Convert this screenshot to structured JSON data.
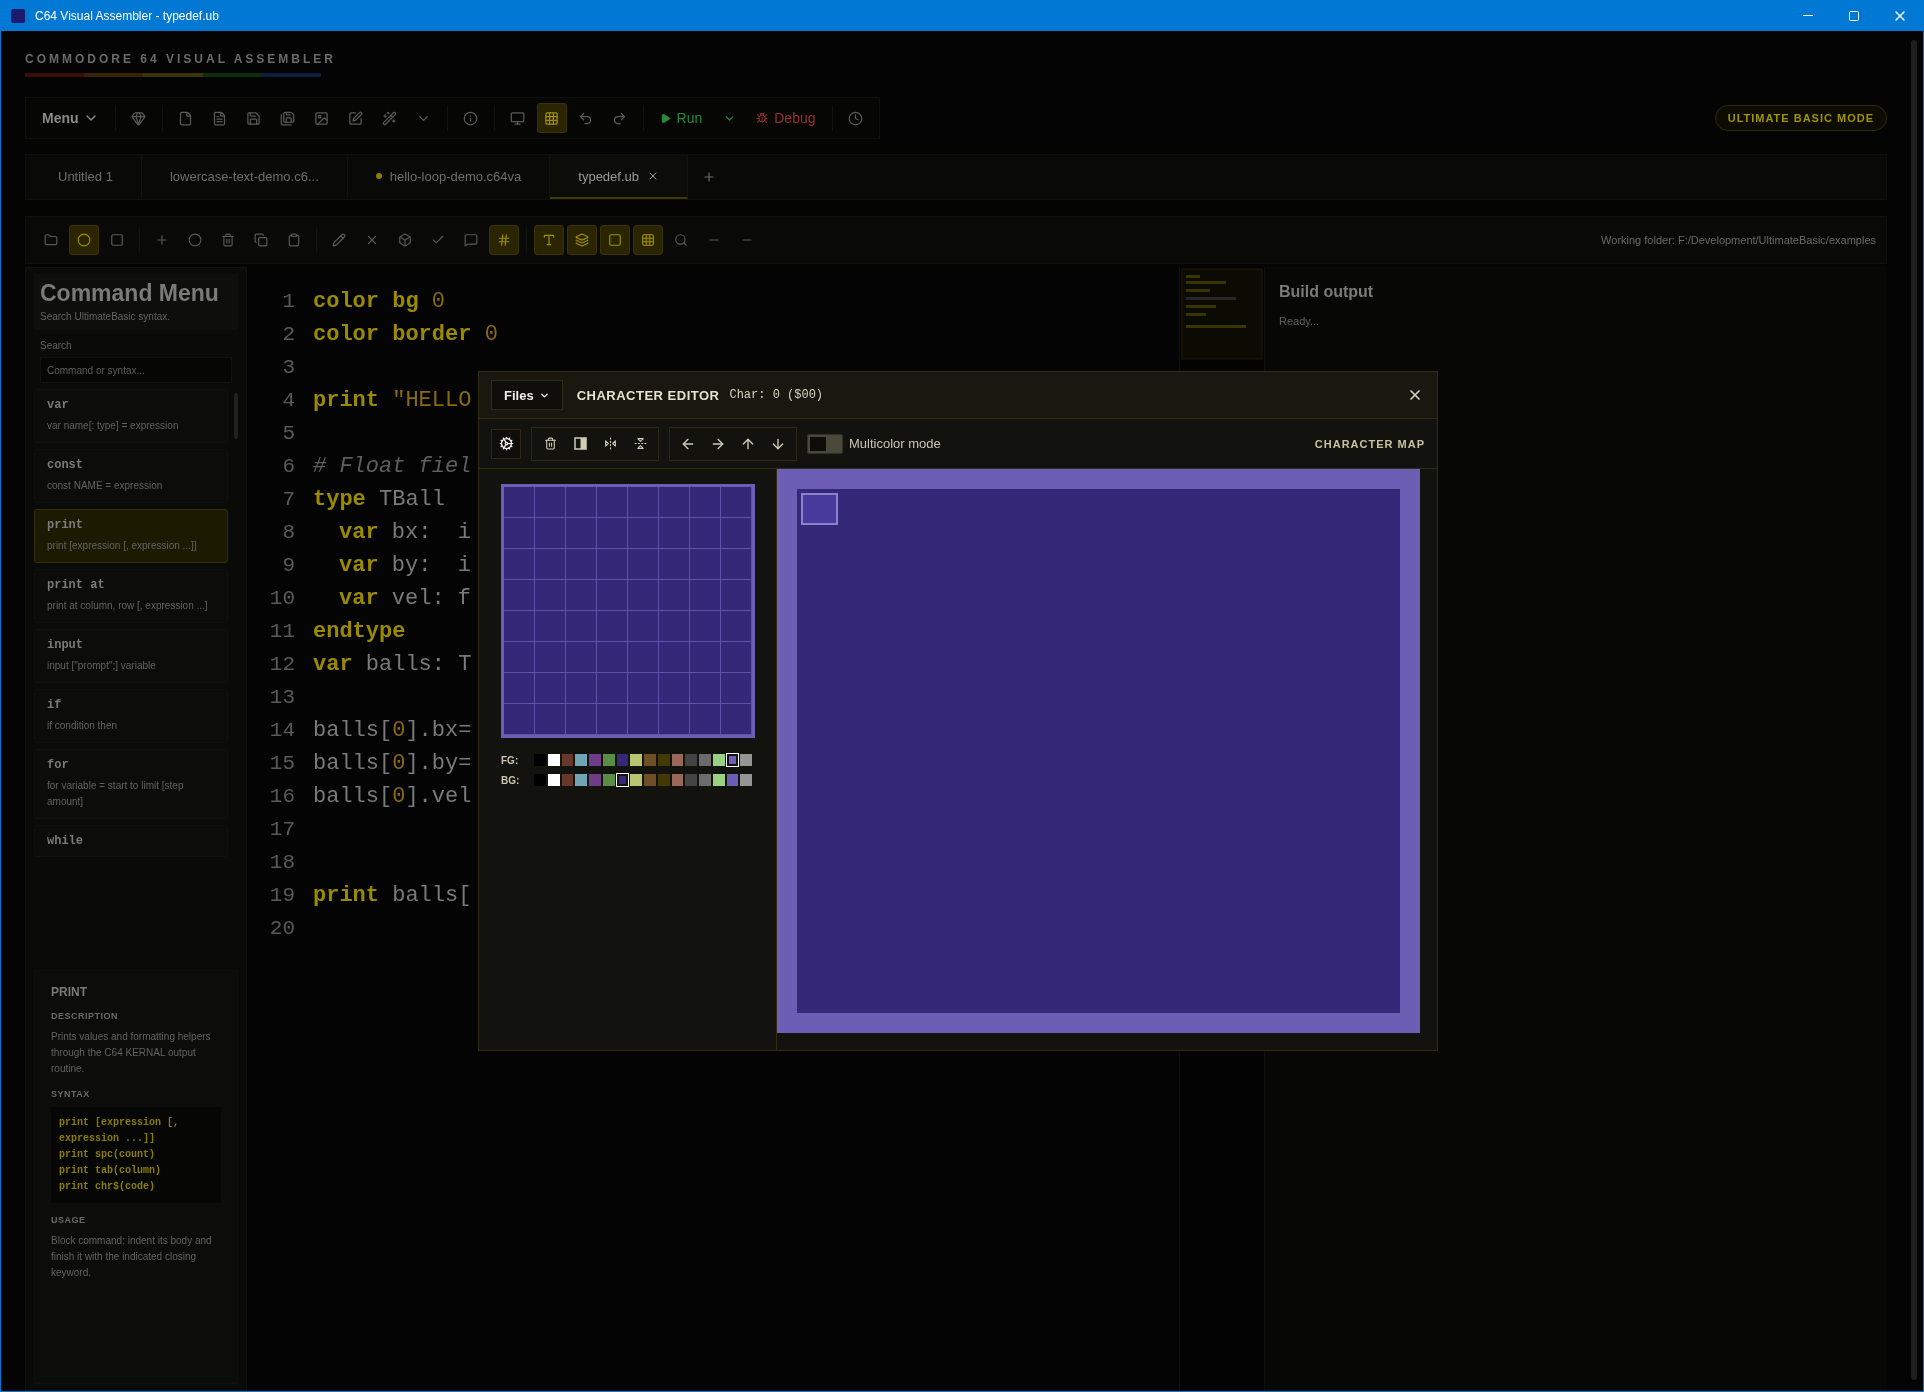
{
  "window": {
    "title": "C64 Visual Assembler - typedef.ub"
  },
  "logo": {
    "text": "COMMODORE 64 VISUAL ASSEMBLER"
  },
  "toolbar": {
    "menu_label": "Menu",
    "run_label": "Run",
    "debug_label": "Debug",
    "mode_badge": "ULTIMATE BASIC MODE",
    "icon_buttons": [
      {
        "active": false
      },
      {
        "active": false
      },
      {
        "active": false
      },
      {
        "active": false
      },
      {
        "active": false
      },
      {
        "active": false
      },
      {
        "active": false
      },
      {
        "active": false
      },
      {
        "active": false
      },
      {
        "active": false
      },
      {
        "active": false
      },
      {
        "active": true
      },
      {
        "active": false
      },
      {
        "active": false
      },
      {
        "active": false
      }
    ]
  },
  "tabs": [
    {
      "label": "Untitled 1",
      "selected": false,
      "modified": false
    },
    {
      "label": "lowercase-text-demo.c6...",
      "selected": false,
      "modified": false
    },
    {
      "label": "hello-loop-demo.c64va",
      "selected": false,
      "modified": true
    },
    {
      "label": "typedef.ub",
      "selected": true,
      "modified": false
    }
  ],
  "editor_toolbar": {
    "working_folder": "Working folder: F:/Development/UltimateBasic/examples",
    "icon_buttons": [
      {
        "active": false
      },
      {
        "active": true
      },
      {
        "active": false
      },
      {
        "active": false
      },
      {
        "active": false
      },
      {
        "active": false
      },
      {
        "active": false
      },
      {
        "active": false
      },
      {
        "active": false
      },
      {
        "active": false
      },
      {
        "active": false
      },
      {
        "active": false
      },
      {
        "active": false
      },
      {
        "active": true
      },
      {
        "active": true
      },
      {
        "active": true
      },
      {
        "active": true
      },
      {
        "active": true
      },
      {
        "active": false
      },
      {
        "active": false
      },
      {
        "active": false
      }
    ]
  },
  "sidebar": {
    "title": "Command Menu",
    "subtitle": "Search UltimateBasic syntax.",
    "search_label": "Search",
    "search_placeholder": "Command or syntax...",
    "commands": [
      {
        "name": "var",
        "syntax": "var name[: type] = expression",
        "selected": false
      },
      {
        "name": "const",
        "syntax": "const NAME = expression",
        "selected": false
      },
      {
        "name": "print",
        "syntax": "print [expression [, expression ...]]",
        "selected": true
      },
      {
        "name": "print at",
        "syntax": "print at column, row [, expression ...]",
        "selected": false
      },
      {
        "name": "input",
        "syntax": "input [\"prompt\";] variable",
        "selected": false
      },
      {
        "name": "if",
        "syntax": "if condition then",
        "selected": false
      },
      {
        "name": "for",
        "syntax": "for variable = start to limit [step amount]",
        "selected": false
      },
      {
        "name": "while",
        "selected": false
      }
    ],
    "details": {
      "title": "PRINT",
      "description_label": "DESCRIPTION",
      "description": "Prints values and formatting helpers through the C64 KERNAL output routine.",
      "syntax_label": "SYNTAX",
      "syntax_lines": [
        "print [expression [, expression ...]]",
        "print spc(count)",
        "print tab(column)",
        "print chr$(code)"
      ],
      "usage_label": "USAGE",
      "usage": "Block command: indent its body and finish it with the indicated closing keyword."
    }
  },
  "editor": {
    "lines": [
      {
        "number": "1",
        "tokens": [
          {
            "kind": "keyword",
            "text": "color bg"
          },
          {
            "kind": "number",
            "text": " 0"
          }
        ]
      },
      {
        "number": "2",
        "tokens": [
          {
            "kind": "keyword",
            "text": "color border"
          },
          {
            "kind": "number",
            "text": " 0"
          }
        ]
      },
      {
        "number": "3"
      },
      {
        "number": "4",
        "tokens": [
          {
            "kind": "keyword",
            "text": "print"
          },
          {
            "kind": "string",
            "text": " \"HELLO"
          }
        ]
      },
      {
        "number": "5"
      },
      {
        "number": "6",
        "tokens": [
          {
            "kind": "comment",
            "text": "# Float fiel"
          }
        ]
      },
      {
        "number": "7",
        "tokens": [
          {
            "kind": "keyword",
            "text": "type"
          },
          {
            "kind": "plain",
            "text": " TBall"
          }
        ],
        "children": [
          {
            "number": "8",
            "tokens": [
              {
                "kind": "keyword",
                "text": "var"
              },
              {
                "kind": "plain",
                "text": " bx:  i"
              }
            ]
          },
          {
            "number": "9",
            "tokens": [
              {
                "kind": "keyword",
                "text": "var"
              },
              {
                "kind": "plain",
                "text": " by:  i"
              }
            ]
          },
          {
            "number": "10",
            "tokens": [
              {
                "kind": "keyword",
                "text": "var"
              },
              {
                "kind": "plain",
                "text": " vel: f"
              }
            ]
          }
        ]
      },
      {
        "number": "11",
        "tokens": [
          {
            "kind": "keyword",
            "text": "endtype"
          }
        ]
      },
      {
        "number": "12",
        "tokens": [
          {
            "kind": "keyword",
            "text": "var"
          },
          {
            "kind": "plain",
            "text": " balls: T"
          }
        ]
      },
      {
        "number": "13"
      },
      {
        "number": "14",
        "tokens": [
          {
            "kind": "plain",
            "text": "balls["
          },
          {
            "kind": "number",
            "text": "0"
          },
          {
            "kind": "plain",
            "text": "].bx="
          }
        ]
      },
      {
        "number": "15",
        "tokens": [
          {
            "kind": "plain",
            "text": "balls["
          },
          {
            "kind": "number",
            "text": "0"
          },
          {
            "kind": "plain",
            "text": "].by="
          }
        ]
      },
      {
        "number": "16",
        "tokens": [
          {
            "kind": "plain",
            "text": "balls["
          },
          {
            "kind": "number",
            "text": "0"
          },
          {
            "kind": "plain",
            "text": "].vel"
          }
        ]
      },
      {
        "number": "17"
      },
      {
        "number": "18"
      },
      {
        "number": "19",
        "tokens": [
          {
            "kind": "keyword",
            "text": "print"
          },
          {
            "kind": "plain",
            "text": " balls["
          }
        ]
      },
      {
        "number": "20"
      }
    ]
  },
  "build_output": {
    "title": "Build output",
    "status": "Ready..."
  },
  "character_editor": {
    "files_button": "Files",
    "title": "CHARACTER EDITOR",
    "char_info": "Char: 0 ($00)",
    "multicolor": {
      "label": "Multicolor mode",
      "on": false
    },
    "character_map_label": "CHARACTER MAP",
    "pixels": [
      [
        false,
        false,
        false,
        false,
        false,
        false,
        false,
        false
      ],
      [
        false,
        false,
        false,
        false,
        false,
        false,
        false,
        false
      ],
      [
        false,
        false,
        false,
        false,
        false,
        false,
        false,
        false
      ],
      [
        false,
        false,
        false,
        false,
        false,
        false,
        false,
        false
      ],
      [
        false,
        false,
        false,
        false,
        false,
        false,
        false,
        false
      ],
      [
        false,
        false,
        false,
        false,
        false,
        false,
        false,
        false
      ],
      [
        false,
        false,
        false,
        false,
        false,
        false,
        false,
        false
      ],
      [
        false,
        false,
        false,
        false,
        false,
        false,
        false,
        false
      ]
    ],
    "palettes": [
      {
        "label": "FG:",
        "swatches": [
          {
            "color": "#000000",
            "selected": false
          },
          {
            "color": "#ffffff",
            "selected": false
          },
          {
            "color": "#68372b",
            "selected": false
          },
          {
            "color": "#70a4b2",
            "selected": false
          },
          {
            "color": "#6f3d86",
            "selected": false
          },
          {
            "color": "#588d43",
            "selected": false
          },
          {
            "color": "#352879",
            "selected": false
          },
          {
            "color": "#b8c76f",
            "selected": false
          },
          {
            "color": "#6f4f25",
            "selected": false
          },
          {
            "color": "#433900",
            "selected": false
          },
          {
            "color": "#9a6759",
            "selected": false
          },
          {
            "color": "#444444",
            "selected": false
          },
          {
            "color": "#6c6c6c",
            "selected": false
          },
          {
            "color": "#9ad284",
            "selected": false
          },
          {
            "color": "#6c5eb5",
            "selected": true
          },
          {
            "color": "#959595",
            "selected": false
          }
        ]
      },
      {
        "label": "BG:",
        "swatches": [
          {
            "color": "#000000",
            "selected": false
          },
          {
            "color": "#ffffff",
            "selected": false
          },
          {
            "color": "#68372b",
            "selected": false
          },
          {
            "color": "#70a4b2",
            "selected": false
          },
          {
            "color": "#6f3d86",
            "selected": false
          },
          {
            "color": "#588d43",
            "selected": false
          },
          {
            "color": "#352879",
            "selected": true
          },
          {
            "color": "#b8c76f",
            "selected": false
          },
          {
            "color": "#6f4f25",
            "selected": false
          },
          {
            "color": "#433900",
            "selected": false
          },
          {
            "color": "#9a6759",
            "selected": false
          },
          {
            "color": "#444444",
            "selected": false
          },
          {
            "color": "#6c6c6c",
            "selected": false
          },
          {
            "color": "#9ad284",
            "selected": false
          },
          {
            "color": "#6c5eb5",
            "selected": false
          },
          {
            "color": "#959595",
            "selected": false
          }
        ]
      }
    ]
  }
}
